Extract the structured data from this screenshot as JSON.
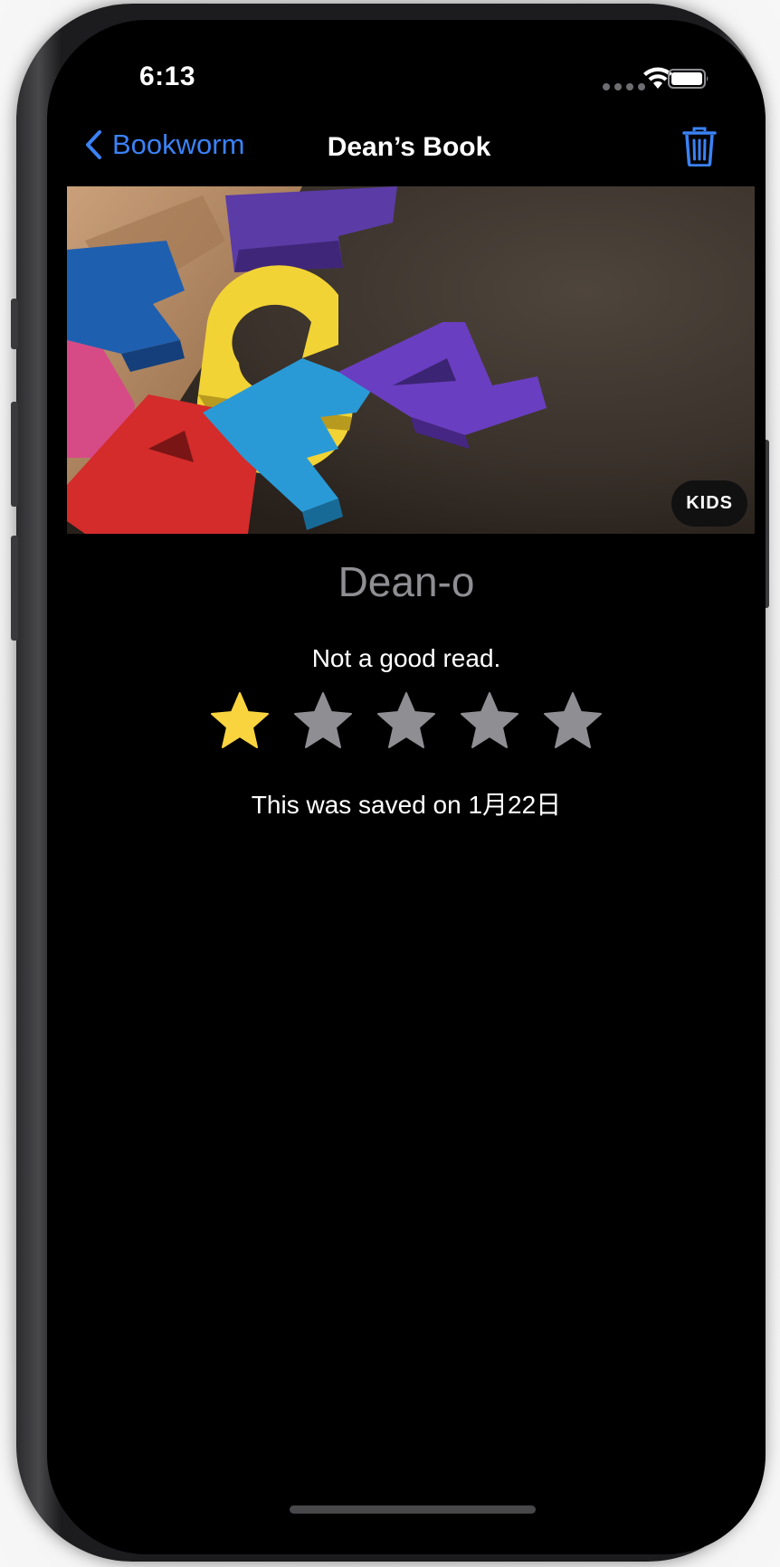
{
  "status_bar": {
    "time": "6:13",
    "icons": [
      "cellular-dots-icon",
      "wifi-icon",
      "battery-icon"
    ]
  },
  "nav": {
    "back_label": "Bookworm",
    "title": "Dean’s Book",
    "trash_icon": "trash-icon",
    "accent_color": "#3b82f6"
  },
  "book": {
    "genre_badge": "KIDS",
    "author": "Dean-o",
    "review": "Not a good read.",
    "rating": 1,
    "rating_max": 5,
    "saved_text": "This was saved on 1月22日"
  },
  "colors": {
    "star_on": "#f9d43f",
    "star_off": "#8e8e93",
    "background": "#000000"
  }
}
